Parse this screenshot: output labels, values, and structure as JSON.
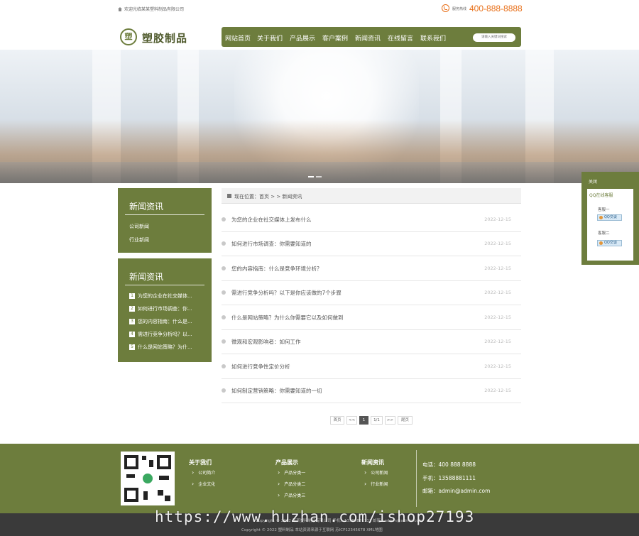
{
  "topbar": {
    "welcome": "欢迎光临某某塑料制品有限公司",
    "hotline_label": "服务热线",
    "phone": "400-888-8888"
  },
  "header": {
    "logo_badge": "塑",
    "logo_text": "塑胶制品",
    "nav": [
      "网站首页",
      "关于我们",
      "产品展示",
      "客户案例",
      "新闻资讯",
      "在线留言",
      "联系我们"
    ],
    "search_placeholder": "请输入关键词搜索"
  },
  "sidebar": {
    "category_title": "新闻资讯",
    "category_links": [
      "公司新闻",
      "行业新闻"
    ],
    "news_title": "新闻资讯",
    "news_items": [
      {
        "num": "1",
        "text": "为您的企业在社交媒体..."
      },
      {
        "num": "2",
        "text": "如何进行市场调查：你..."
      },
      {
        "num": "3",
        "text": "您的内容指南：什么是..."
      },
      {
        "num": "4",
        "text": "需进行竞争分析吗？以..."
      },
      {
        "num": "5",
        "text": "什么是网站策略？为什..."
      }
    ]
  },
  "breadcrumb": "现在位置：首页 > > 新闻资讯",
  "articles": [
    {
      "title": "为您的企业在社交媒体上发布什么",
      "date": "2022-12-15"
    },
    {
      "title": "如何进行市场调查：你需要知道的",
      "date": "2022-12-15"
    },
    {
      "title": "您的内容指南：什么是竞争环境分析？",
      "date": "2022-12-15"
    },
    {
      "title": "需进行竞争分析吗？以下是你应该做的7个步骤",
      "date": "2022-12-15"
    },
    {
      "title": "什么是网站策略？为什么你需要它以及如何做到",
      "date": "2022-12-15"
    },
    {
      "title": "微观和宏观影响者：如何工作",
      "date": "2022-12-15"
    },
    {
      "title": "如何进行竞争性定价分析",
      "date": "2022-12-15"
    },
    {
      "title": "如何制定营销策略：你需要知道的一切",
      "date": "2022-12-15"
    }
  ],
  "pager": {
    "first": "首页",
    "prev": "<<",
    "current": "1",
    "info": "1/1",
    "next": ">>",
    "last": "尾页"
  },
  "qq_panel": {
    "title": "关闭",
    "inner_title": "QQ在线客服",
    "agents": [
      "客服一",
      "客服二"
    ],
    "chat_label": "QQ交谈"
  },
  "footer": {
    "columns": [
      {
        "title": "关于我们",
        "links": [
          "公司简介",
          "企业文化"
        ]
      },
      {
        "title": "产品展示",
        "links": [
          "产品分类一",
          "产品分类二",
          "产品分类三"
        ]
      },
      {
        "title": "新闻资讯",
        "links": [
          "公司新闻",
          "行业新闻"
        ]
      }
    ],
    "contact": {
      "tel": "电话：400 888 8888",
      "mobile": "手机：13588881111",
      "email": "邮箱：admin@admin.com"
    },
    "copyright_line1": "Copyright © 2022 某某塑料制品有限公司 手机：13588881111 邮箱：admin@admin.com",
    "copyright_line2": "Copyright © 2022 塑料制品 本站资源来源于互联网 苏ICP12345678 XML地图"
  },
  "watermark": "https://www.huzhan.com/ishop27193",
  "colors": {
    "brand_green": "#6d7d3d",
    "accent_orange": "#e8701a",
    "footer_dark": "#3a3a3a"
  }
}
